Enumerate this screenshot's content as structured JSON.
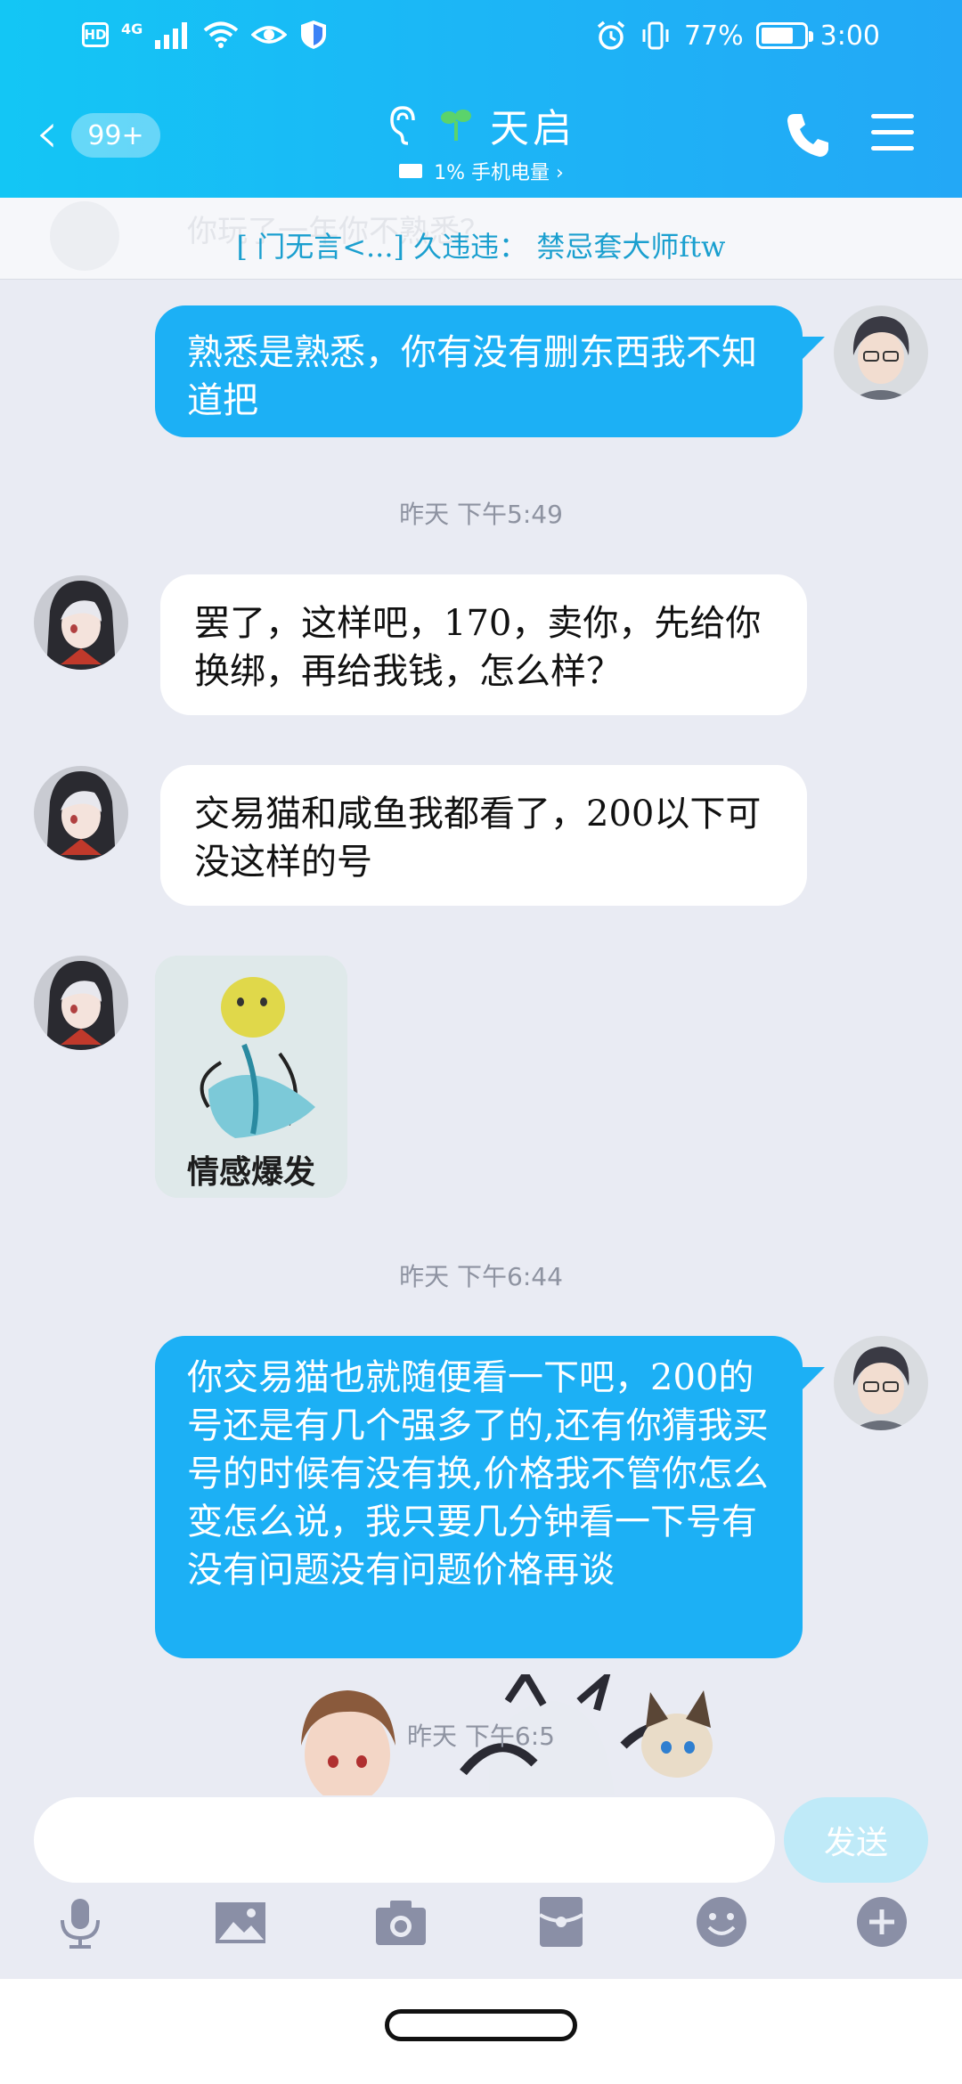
{
  "status_bar": {
    "hd": "HD",
    "network": "4G",
    "battery_text": "77%",
    "battery_level": 0.77,
    "time": "3:00"
  },
  "header": {
    "back_badge": "99+",
    "contact_name": "天启",
    "subtitle": "1% 手机电量 ›"
  },
  "notice": {
    "ghost_text": "你玩了一年你不熟悉？",
    "text": "[ 门无言<...] 久违违： 禁忌套大师ftw"
  },
  "messages": [
    {
      "type": "text",
      "direction": "out",
      "text": "熟悉是熟悉，你有没有删东西我不知道把"
    },
    {
      "type": "time",
      "text": "昨天 下午5:49"
    },
    {
      "type": "text",
      "direction": "in",
      "text": "罢了，这样吧，170，卖你，先给你换绑，再给我钱，怎么样？"
    },
    {
      "type": "text",
      "direction": "in",
      "text": "交易猫和咸鱼我都看了，200以下可没这样的号"
    },
    {
      "type": "sticker",
      "direction": "in",
      "caption": "情感爆发"
    },
    {
      "type": "time",
      "text": "昨天 下午6:44"
    },
    {
      "type": "text",
      "direction": "out",
      "text": "你交易猫也就随便看一下吧，200的号还是有几个强多了的,还有你猜我买号的时候有没有换,价格我不管你怎么变怎么说，我只要几分钟看一下号有没有问题没有问题价格再谈"
    },
    {
      "type": "time",
      "text": "昨天 下午6:5"
    }
  ],
  "input": {
    "value": "",
    "send_label": "发送"
  },
  "toolbar": [
    "microphone-icon",
    "image-icon",
    "camera-icon",
    "red-packet-icon",
    "emoji-icon",
    "plus-icon"
  ],
  "colors": {
    "header_start": "#13c6f5",
    "header_end": "#23a8f6",
    "outgoing_bubble": "#1cb0f5",
    "incoming_bubble": "#ffffff",
    "chat_bg": "#e9ebf3",
    "timestamp": "#8e93a1",
    "toolbar_icon": "#8a8fa6"
  }
}
